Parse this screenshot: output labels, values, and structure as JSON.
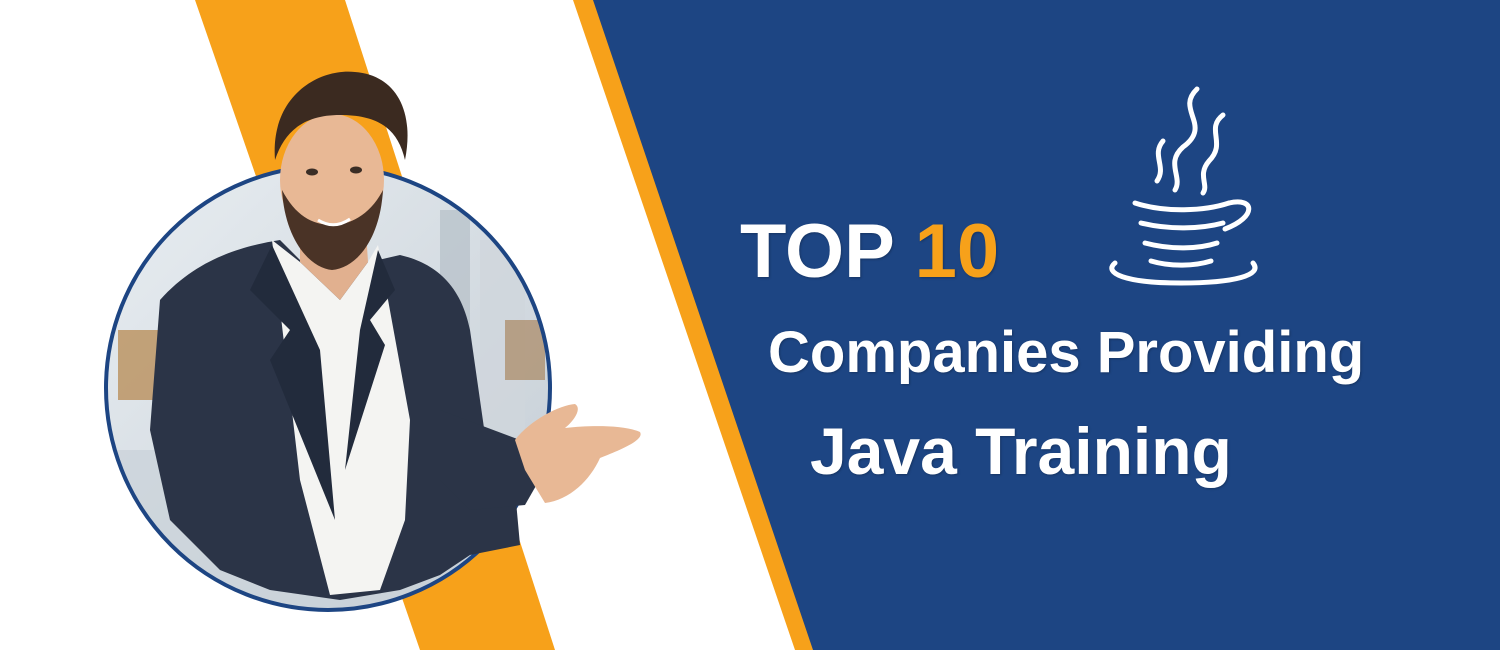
{
  "headline": {
    "top_prefix": "TOP",
    "top_number": "10",
    "line2": "Companies Providing",
    "line3": "Java Training"
  },
  "colors": {
    "navy": "#1d4583",
    "orange": "#f7a11a",
    "white": "#ffffff",
    "text": "#ffffff"
  },
  "icons": {
    "logo": "java-coffee-cup-icon"
  }
}
